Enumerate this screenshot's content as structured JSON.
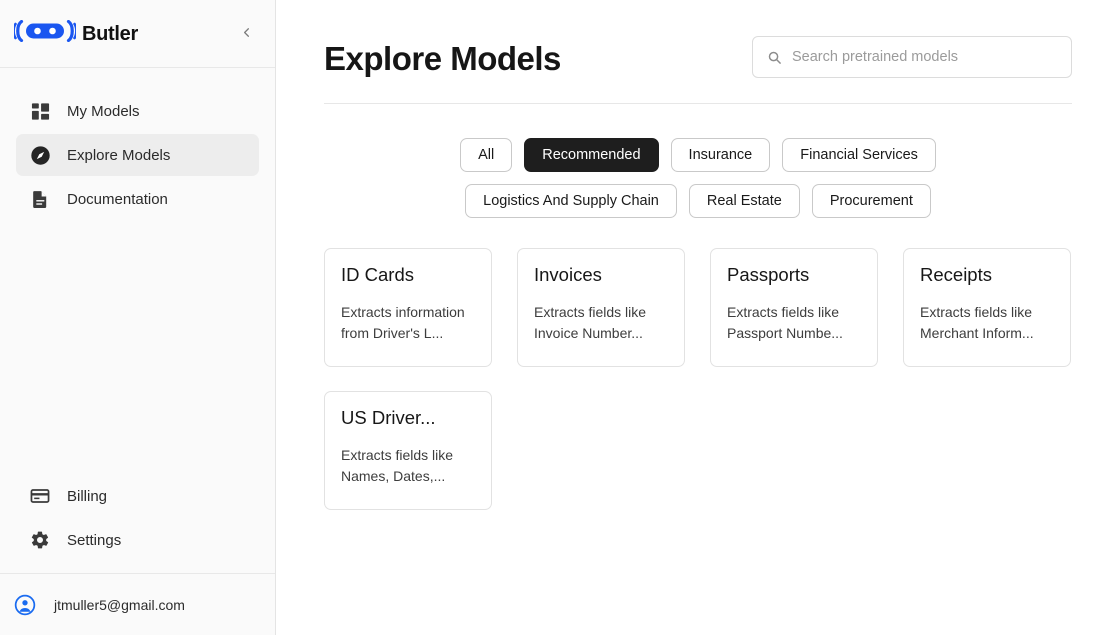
{
  "sidebar": {
    "brand": {
      "name": "Butler",
      "logo_icon": "butler-robot-logo",
      "logo_color": "#1a56f0"
    },
    "collapse_icon": "chevron-left-icon",
    "top_items": [
      {
        "label": "My Models",
        "icon": "grid-dashboard-icon",
        "active": false
      },
      {
        "label": "Explore Models",
        "icon": "compass-icon",
        "active": true
      },
      {
        "label": "Documentation",
        "icon": "document-icon",
        "active": false
      }
    ],
    "bottom_items": [
      {
        "label": "Billing",
        "icon": "credit-card-icon",
        "active": false
      },
      {
        "label": "Settings",
        "icon": "gear-icon",
        "active": false
      }
    ],
    "account": {
      "email": "jtmuller5@gmail.com",
      "avatar_icon": "account-circle-icon",
      "avatar_color": "#1a6bf0"
    }
  },
  "header": {
    "title": "Explore Models"
  },
  "search": {
    "placeholder": "Search pretrained models",
    "value": "",
    "icon": "search-icon"
  },
  "filters": {
    "chips": [
      {
        "label": "All",
        "active": false
      },
      {
        "label": "Recommended",
        "active": true
      },
      {
        "label": "Insurance",
        "active": false
      },
      {
        "label": "Financial Services",
        "active": false
      },
      {
        "label": "Logistics And Supply Chain",
        "active": false
      },
      {
        "label": "Real Estate",
        "active": false
      },
      {
        "label": "Procurement",
        "active": false
      }
    ],
    "active_color": "#1e1e1e"
  },
  "models": [
    {
      "title": "ID Cards",
      "description": "Extracts information from Driver's L..."
    },
    {
      "title": "Invoices",
      "description": "Extracts fields like Invoice Number..."
    },
    {
      "title": "Passports",
      "description": "Extracts fields like Passport Numbe..."
    },
    {
      "title": "Receipts",
      "description": "Extracts fields like Merchant Inform..."
    },
    {
      "title": "US Driver...",
      "description": "Extracts fields like Names, Dates,..."
    }
  ]
}
